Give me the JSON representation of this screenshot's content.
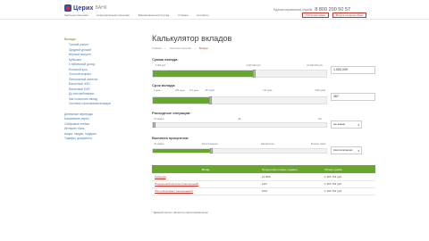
{
  "header": {
    "logo_text": "Церих",
    "logo_sub": "БАНК",
    "nav": [
      "Частным клиентам",
      "Корпоративным клиентам",
      "Финансовым институтам",
      "О банке",
      "Контакты"
    ],
    "hotline_label": "Единая справочная служба",
    "hotline_number": "8 800 200 50 57",
    "feedback_button": "Обратная связь",
    "ibank_button": "Вход в интернет-банк"
  },
  "sidebar": {
    "heading": "Вклады",
    "items": [
      "Точный расчет",
      "Щедрый урожай",
      "Верный процент",
      "Кубышка",
      "Стабильный доход",
      "Большой куш",
      "Золотой возраст",
      "Пенсионный капитал",
      "Валютный USD",
      "Валютный EUR",
      "До востребования",
      "Как пополнить вклад",
      "Система страхования вкладов"
    ],
    "sections": [
      "Денежные переводы",
      "Банковские карты",
      "Сейфовые ячейки",
      "Интернет банк",
      "Акции, скидки, подарки",
      "Тарифы, документы"
    ]
  },
  "main": {
    "title": "Калькулятор вкладов",
    "breadcrumbs": [
      "Главная",
      "—",
      "Частным клиентам",
      "—",
      "Вклады"
    ],
    "amount": {
      "label": "Сумма вклада:",
      "value": "1 000 000",
      "fraction": 0.58,
      "ticks": [
        "5 000 руб.",
        "1 000 000 руб.",
        "10 000 000 руб."
      ]
    },
    "term": {
      "label": "Срок вклада:",
      "value": "367",
      "fraction": 0.33,
      "ticks": [
        "1 день",
        "181 день",
        "271 день",
        "367 дней",
        "731 день",
        "1100 дней"
      ]
    },
    "expenses": {
      "label": "Расходные операции:",
      "select": "Не важно",
      "ticks": [
        "Не важно",
        "Да",
        "Нет"
      ]
    },
    "payout": {
      "label": "Выплата процентов:",
      "select": "Капитализация",
      "ticks": [
        "Не важно",
        "Капитализация",
        "Ежемесячно",
        "В конце срока"
      ]
    }
  },
  "results": {
    "headers": [
      "Вклад",
      "Процентная ставка, годовых",
      "Общая сумма"
    ],
    "rows": [
      {
        "name": "Кубышка",
        "rate": "11.00%",
        "total": "1 115 719 руб."
      },
      {
        "name": "Пенсионный капитал (пенсионный)",
        "rate": "11%",
        "total": "1 115 719 руб."
      },
      {
        "name": "Золотой возраст (пенсионный)",
        "rate": "10%",
        "total": "1 104 713 руб."
      }
    ],
    "note": "* Данный расчет является ориентировочным"
  },
  "colors": {
    "accent_green": "#67a72b",
    "brand_blue": "#2b3a86",
    "brand_red": "#c0392b"
  }
}
